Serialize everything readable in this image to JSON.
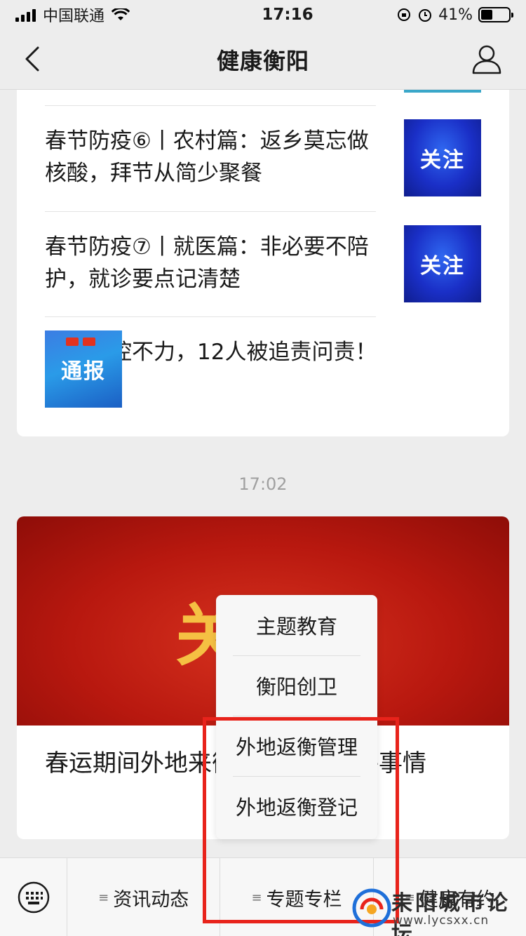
{
  "status_bar": {
    "carrier": "中国联通",
    "time": "17:16",
    "battery": "41%",
    "battery_level": 0.41
  },
  "nav": {
    "title": "健康衡阳"
  },
  "articles": [
    {
      "title": "春节防疫⑥丨农村篇：返乡莫忘做核酸，拜节从简少聚餐",
      "thumb_text": "关注"
    },
    {
      "title": "春节防疫⑦丨就医篇：非必要不陪护，就诊要点记清楚",
      "thumb_text": "关注"
    },
    {
      "title": "疫情防控不力，12人被追责问责！",
      "thumb_text": "通报"
    }
  ],
  "timestamp": "17:02",
  "featured": {
    "banner_text": "关注",
    "title": "春运期间外地来衡人员先做这件事情"
  },
  "popup_menu": {
    "items": [
      "主题教育",
      "衡阳创卫",
      "外地返衡管理",
      "外地返衡登记"
    ]
  },
  "bottom_menu": {
    "tabs": [
      "资讯动态",
      "专题专栏",
      "健康有约"
    ]
  },
  "watermark": {
    "text": "耒阳城市论坛",
    "url": "www.lycsxx.cn"
  },
  "colors": {
    "highlight": "#e8231b",
    "banner_red": "#c4200f",
    "thumb_blue": "#1a2fc7"
  }
}
